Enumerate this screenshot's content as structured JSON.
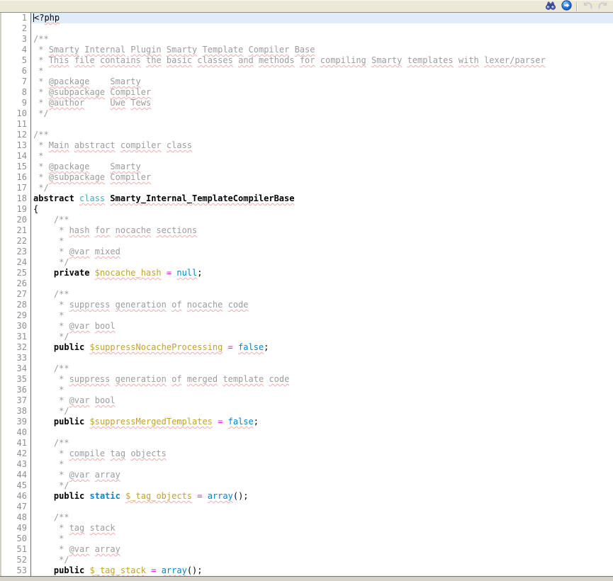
{
  "toolbar": {
    "buttons": [
      {
        "id": "find",
        "icon": "binoculars-icon",
        "disabled": false
      },
      {
        "id": "go",
        "icon": "go-globe-icon",
        "disabled": false
      },
      {
        "id": "undo",
        "icon": "undo-arrow-icon",
        "disabled": true
      },
      {
        "id": "redo",
        "icon": "redo-arrow-icon",
        "disabled": true
      }
    ]
  },
  "editor": {
    "language": "php",
    "active_line": 1,
    "caret": {
      "line": 1,
      "col": 0
    },
    "colors": {
      "c-activeline": "#DFEDF9",
      "c-linenum": "#8F8F8F",
      "c-comment": "#9C9C9C",
      "c-gold": "#C2A12D",
      "c-blue": "#0087CE",
      "c-cyan": "#4FA6C4",
      "c-magenta": "#DD22DD",
      "c-squiggle": "#F2ABAB"
    },
    "token_styles": {
      "p": "plain",
      "pw": "plain-squiggle",
      "k": "keyword-bold",
      "b": "keyword-blue",
      "bw": "literal-blue-squiggle",
      "cw": "class-keyword",
      "n": "class-name",
      "v": "variable",
      "o": "operator",
      "c": "comment"
    },
    "lines": [
      [
        [
          "p",
          "<?"
        ],
        [
          "pw",
          "php"
        ]
      ],
      [],
      [
        [
          "c",
          "/**"
        ]
      ],
      [
        [
          "c",
          " * Smarty Internal Plugin Smarty Template Compiler Base"
        ]
      ],
      [
        [
          "c",
          " * This file contains the basic classes and methods for compiling Smarty templates with lexer/parser"
        ]
      ],
      [
        [
          "c",
          " *"
        ]
      ],
      [
        [
          "c",
          " * @package    Smarty"
        ]
      ],
      [
        [
          "c",
          " * @subpackage Compiler"
        ]
      ],
      [
        [
          "c",
          " * @author     Uwe Tews"
        ]
      ],
      [
        [
          "c",
          " */"
        ]
      ],
      [],
      [
        [
          "c",
          "/**"
        ]
      ],
      [
        [
          "c",
          " * Main abstract compiler class"
        ]
      ],
      [
        [
          "c",
          " *"
        ]
      ],
      [
        [
          "c",
          " * @package    Smarty"
        ]
      ],
      [
        [
          "c",
          " * @subpackage Compiler"
        ]
      ],
      [
        [
          "c",
          " */"
        ]
      ],
      [
        [
          "k",
          "abstract"
        ],
        [
          "p",
          " "
        ],
        [
          "cw",
          "class"
        ],
        [
          "p",
          " "
        ],
        [
          "n",
          "Smarty_Internal_TemplateCompilerBase"
        ]
      ],
      [
        [
          "p",
          "{"
        ]
      ],
      [
        [
          "c",
          "    /**"
        ]
      ],
      [
        [
          "c",
          "     * hash for nocache sections"
        ]
      ],
      [
        [
          "c",
          "     *"
        ]
      ],
      [
        [
          "c",
          "     * @var mixed"
        ]
      ],
      [
        [
          "c",
          "     */"
        ]
      ],
      [
        [
          "p",
          "    "
        ],
        [
          "k",
          "private"
        ],
        [
          "p",
          " "
        ],
        [
          "v",
          "$nocache_hash"
        ],
        [
          "p",
          " "
        ],
        [
          "o",
          "="
        ],
        [
          "p",
          " "
        ],
        [
          "bw",
          "null"
        ],
        [
          "p",
          ";"
        ]
      ],
      [],
      [
        [
          "c",
          "    /**"
        ]
      ],
      [
        [
          "c",
          "     * suppress generation of nocache code"
        ]
      ],
      [
        [
          "c",
          "     *"
        ]
      ],
      [
        [
          "c",
          "     * @var bool"
        ]
      ],
      [
        [
          "c",
          "     */"
        ]
      ],
      [
        [
          "p",
          "    "
        ],
        [
          "k",
          "public"
        ],
        [
          "p",
          " "
        ],
        [
          "v",
          "$suppressNocacheProcessing"
        ],
        [
          "p",
          " "
        ],
        [
          "o",
          "="
        ],
        [
          "p",
          " "
        ],
        [
          "bw",
          "false"
        ],
        [
          "p",
          ";"
        ]
      ],
      [],
      [
        [
          "c",
          "    /**"
        ]
      ],
      [
        [
          "c",
          "     * suppress generation of merged template code"
        ]
      ],
      [
        [
          "c",
          "     *"
        ]
      ],
      [
        [
          "c",
          "     * @var bool"
        ]
      ],
      [
        [
          "c",
          "     */"
        ]
      ],
      [
        [
          "p",
          "    "
        ],
        [
          "k",
          "public"
        ],
        [
          "p",
          " "
        ],
        [
          "v",
          "$suppressMergedTemplates"
        ],
        [
          "p",
          " "
        ],
        [
          "o",
          "="
        ],
        [
          "p",
          " "
        ],
        [
          "bw",
          "false"
        ],
        [
          "p",
          ";"
        ]
      ],
      [],
      [
        [
          "c",
          "    /**"
        ]
      ],
      [
        [
          "c",
          "     * compile tag objects"
        ]
      ],
      [
        [
          "c",
          "     *"
        ]
      ],
      [
        [
          "c",
          "     * @var array"
        ]
      ],
      [
        [
          "c",
          "     */"
        ]
      ],
      [
        [
          "p",
          "    "
        ],
        [
          "k",
          "public"
        ],
        [
          "p",
          " "
        ],
        [
          "b",
          "static"
        ],
        [
          "p",
          " "
        ],
        [
          "v",
          "$_tag_objects"
        ],
        [
          "p",
          " "
        ],
        [
          "o",
          "="
        ],
        [
          "p",
          " "
        ],
        [
          "bw",
          "array"
        ],
        [
          "p",
          "();"
        ]
      ],
      [],
      [
        [
          "c",
          "    /**"
        ]
      ],
      [
        [
          "c",
          "     * tag stack"
        ]
      ],
      [
        [
          "c",
          "     *"
        ]
      ],
      [
        [
          "c",
          "     * @var array"
        ]
      ],
      [
        [
          "c",
          "     */"
        ]
      ],
      [
        [
          "p",
          "    "
        ],
        [
          "k",
          "public"
        ],
        [
          "p",
          " "
        ],
        [
          "v",
          "$_tag_stack"
        ],
        [
          "p",
          " "
        ],
        [
          "o",
          "="
        ],
        [
          "p",
          " "
        ],
        [
          "bw",
          "array"
        ],
        [
          "p",
          "();"
        ]
      ]
    ]
  }
}
